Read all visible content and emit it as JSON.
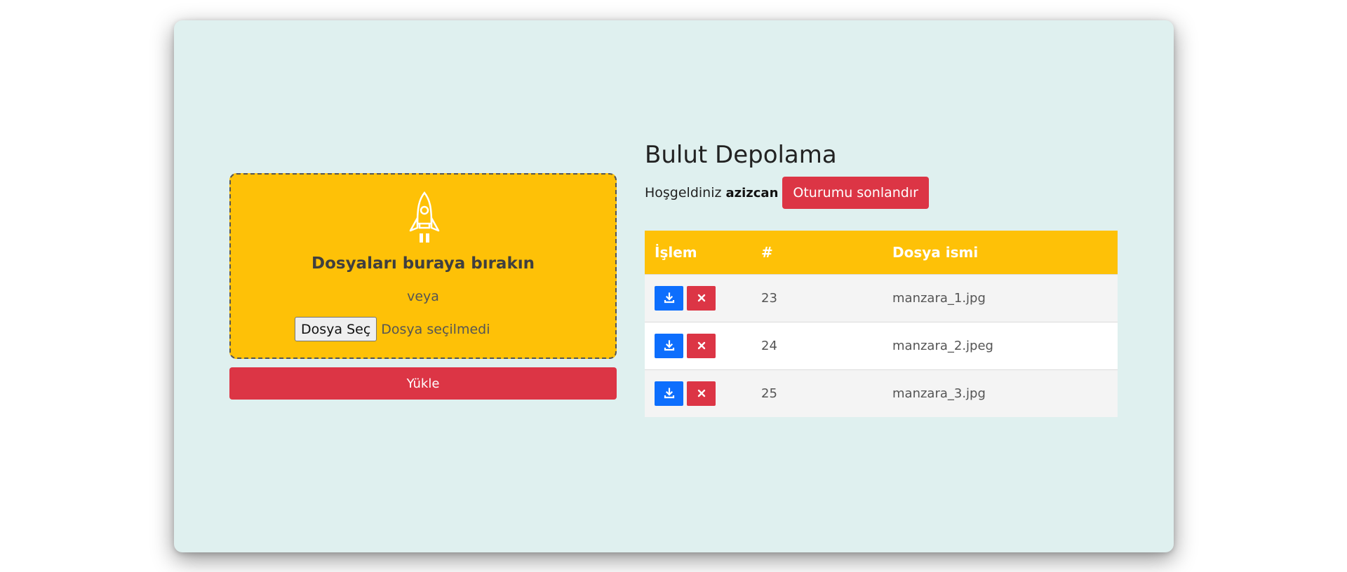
{
  "upload": {
    "dropzone_title": "Dosyaları buraya bırakın",
    "or_text": "veya",
    "choose_file_label": "Dosya Seç",
    "no_file_text": "Dosya seçilmedi",
    "upload_button_label": "Yükle",
    "icon": "rocket-icon"
  },
  "header": {
    "title": "Bulut Depolama",
    "welcome_text": "Hoşgeldiniz",
    "username": "azizcan",
    "logout_label": "Oturumu sonlandır"
  },
  "table": {
    "columns": [
      "İşlem",
      "#",
      "Dosya ismi"
    ],
    "rows": [
      {
        "id": "23",
        "filename": "manzara_1.jpg"
      },
      {
        "id": "24",
        "filename": "manzara_2.jpeg"
      },
      {
        "id": "25",
        "filename": "manzara_3.jpg"
      }
    ],
    "row_actions": [
      "download-icon",
      "close-icon"
    ]
  },
  "colors": {
    "card_background": "#dff0ef",
    "accent_yellow": "#fec107",
    "danger_red": "#dc3545",
    "primary_blue": "#0d6efd"
  }
}
